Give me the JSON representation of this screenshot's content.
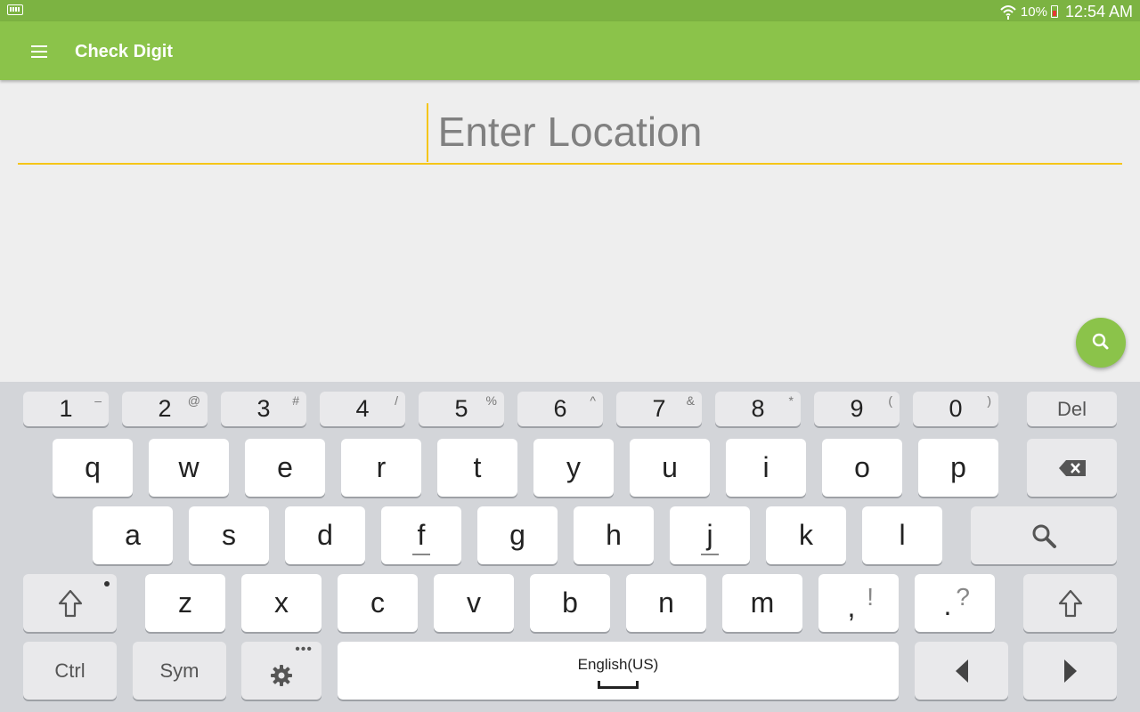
{
  "status_bar": {
    "battery": "10%",
    "time": "12:54 AM",
    "icons": [
      "keyboard-indicator-icon",
      "wifi-icon",
      "battery-low-icon"
    ]
  },
  "app_bar": {
    "title": "Check Digit",
    "menu_icon": "hamburger-menu-icon",
    "color": "#8bc34a"
  },
  "location": {
    "placeholder": "Enter Location",
    "value": "",
    "underline_color": "#f5c518"
  },
  "fab": {
    "icon": "search-icon"
  },
  "keyboard": {
    "number_row": [
      {
        "main": "1",
        "sub": "–"
      },
      {
        "main": "2",
        "sub": "@"
      },
      {
        "main": "3",
        "sub": "#"
      },
      {
        "main": "4",
        "sub": "/"
      },
      {
        "main": "5",
        "sub": "%"
      },
      {
        "main": "6",
        "sub": "^"
      },
      {
        "main": "7",
        "sub": "&"
      },
      {
        "main": "8",
        "sub": "*"
      },
      {
        "main": "9",
        "sub": "("
      },
      {
        "main": "0",
        "sub": ")"
      }
    ],
    "del_label": "Del",
    "row1": [
      "q",
      "w",
      "e",
      "r",
      "t",
      "y",
      "u",
      "i",
      "o",
      "p"
    ],
    "row2": [
      "a",
      "s",
      "d",
      "f",
      "g",
      "h",
      "j",
      "k",
      "l"
    ],
    "row3": [
      "z",
      "x",
      "c",
      "v",
      "b",
      "n",
      "m"
    ],
    "comma_key": {
      "main": ",",
      "sub": "!"
    },
    "period_key": {
      "main": ".",
      "sub": "?"
    },
    "ctrl_label": "Ctrl",
    "sym_label": "Sym",
    "space_label": "English(US)"
  }
}
